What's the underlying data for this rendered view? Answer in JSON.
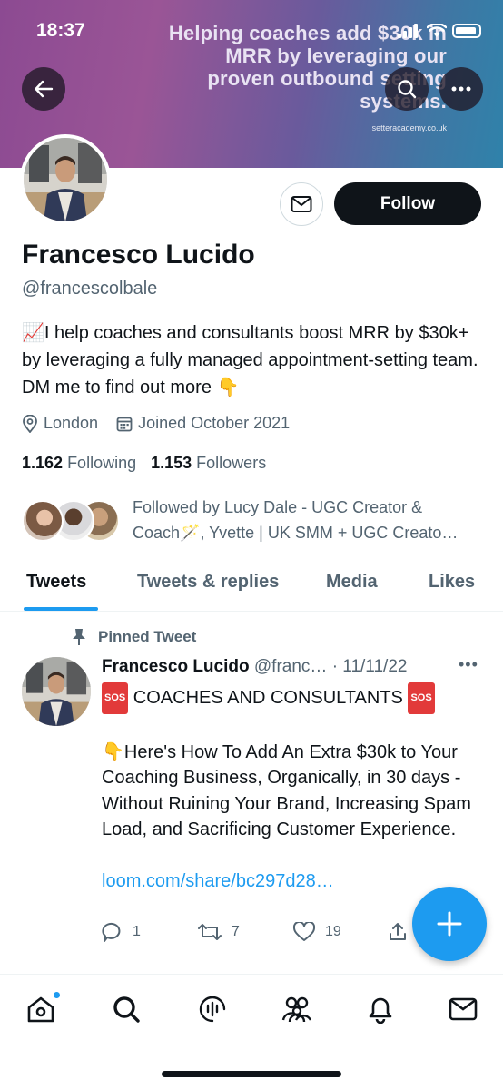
{
  "status_bar": {
    "time": "18:37"
  },
  "banner": {
    "text": "Helping coaches add $30k in MRR by leveraging our proven outbound setting systems.",
    "url": "setteracademy.co.uk"
  },
  "profile": {
    "name": "Francesco Lucido",
    "handle": "@francescolbale",
    "bio": "📈I help coaches and consultants boost MRR by $30k+ by leveraging a fully managed appointment-setting team. DM me to find out more 👇",
    "location": "London",
    "joined": "Joined October 2021",
    "following_count": "1.162",
    "following_label": "Following",
    "followers_count": "1.153",
    "followers_label": "Followers",
    "followed_by_line1": "Followed by Lucy Dale - UGC Creator &",
    "followed_by_line2": "Coach🪄, Yvette | UK SMM + UGC Creato…"
  },
  "buttons": {
    "follow": "Follow"
  },
  "tabs": [
    {
      "label": "Tweets",
      "active": true
    },
    {
      "label": "Tweets & replies",
      "active": false
    },
    {
      "label": "Media",
      "active": false
    },
    {
      "label": "Likes",
      "active": false
    }
  ],
  "tweet": {
    "pinned_label": "Pinned Tweet",
    "author": "Francesco Lucido",
    "handle": "@franc…",
    "date": "· 11/11/22",
    "headline": "COACHES AND CONSULTANTS",
    "sos": "SOS",
    "body": "👇Here's How To Add An Extra $30k to Your Coaching Business, Organically, in 30 days - Without Ruining Your Brand, Increasing Spam Load, and Sacrificing Customer Experience.",
    "link": "loom.com/share/bc297d28…",
    "replies": "1",
    "retweets": "7",
    "likes": "19"
  },
  "colors": {
    "accent": "#1d9bf0",
    "text": "#0f1419",
    "secondary": "#536471"
  },
  "icons": {
    "nav": [
      "home-icon",
      "search-icon",
      "spaces-icon",
      "communities-icon",
      "notifications-icon",
      "messages-icon"
    ]
  }
}
